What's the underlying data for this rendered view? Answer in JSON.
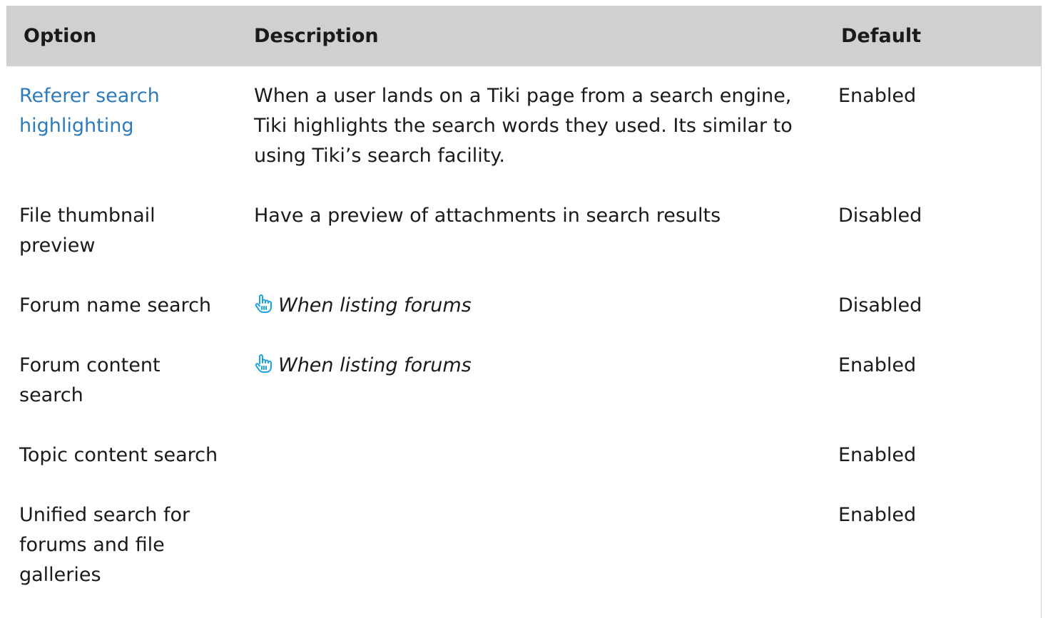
{
  "table": {
    "headers": {
      "option": "Option",
      "description": "Description",
      "default": "Default"
    },
    "rows": [
      {
        "option": "Referer search highlighting",
        "option_is_link": true,
        "description": "When a user lands on a Tiki page from a search engine, Tiki highlights the search words they used. Its similar to using Tiki’s search facility.",
        "description_icon": "",
        "default": "Enabled"
      },
      {
        "option": "File thumbnail preview",
        "option_is_link": false,
        "description": "Have a preview of attachments in search results",
        "description_icon": "",
        "default": "Disabled"
      },
      {
        "option": "Forum name search",
        "option_is_link": false,
        "description": "When listing forums",
        "description_icon": "pointing-hand-icon",
        "default": "Disabled"
      },
      {
        "option": "Forum content search",
        "option_is_link": false,
        "description": "When listing forums",
        "description_icon": "pointing-hand-icon",
        "default": "Enabled"
      },
      {
        "option": "Topic content search",
        "option_is_link": false,
        "description": "",
        "description_icon": "",
        "default": "Enabled"
      },
      {
        "option": "Unified search for forums and file galleries",
        "option_is_link": false,
        "description": "",
        "description_icon": "",
        "default": "Enabled"
      }
    ]
  },
  "colors": {
    "header_bg": "#d0d0d0",
    "link": "#2f7ab8",
    "icon": "#1fa3e0"
  }
}
